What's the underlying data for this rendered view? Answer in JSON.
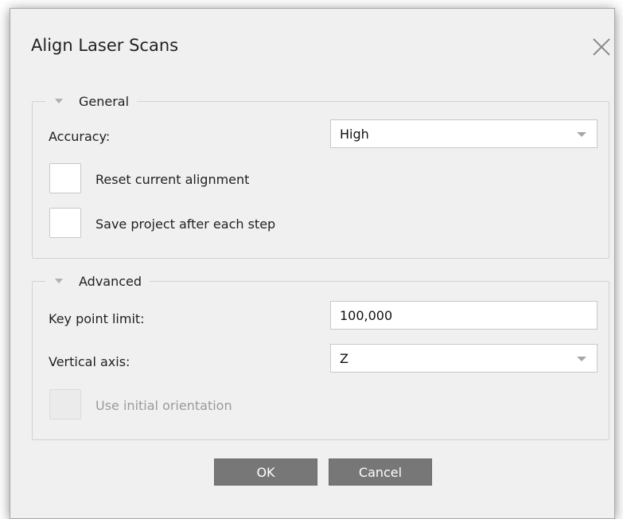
{
  "dialog": {
    "title": "Align Laser Scans",
    "close_icon": "close-icon"
  },
  "general": {
    "legend": "General",
    "accuracy_label": "Accuracy:",
    "accuracy_value": "High",
    "reset_label": "Reset current alignment",
    "reset_checked": false,
    "save_label": "Save project after each step",
    "save_checked": false
  },
  "advanced": {
    "legend": "Advanced",
    "keypoint_label": "Key point limit:",
    "keypoint_value": "100,000",
    "vertical_label": "Vertical axis:",
    "vertical_value": "Z",
    "orientation_label": "Use initial orientation",
    "orientation_enabled": false
  },
  "buttons": {
    "ok": "OK",
    "cancel": "Cancel"
  },
  "colors": {
    "button_bg": "#777777",
    "dialog_bg": "#f0f0f0"
  }
}
